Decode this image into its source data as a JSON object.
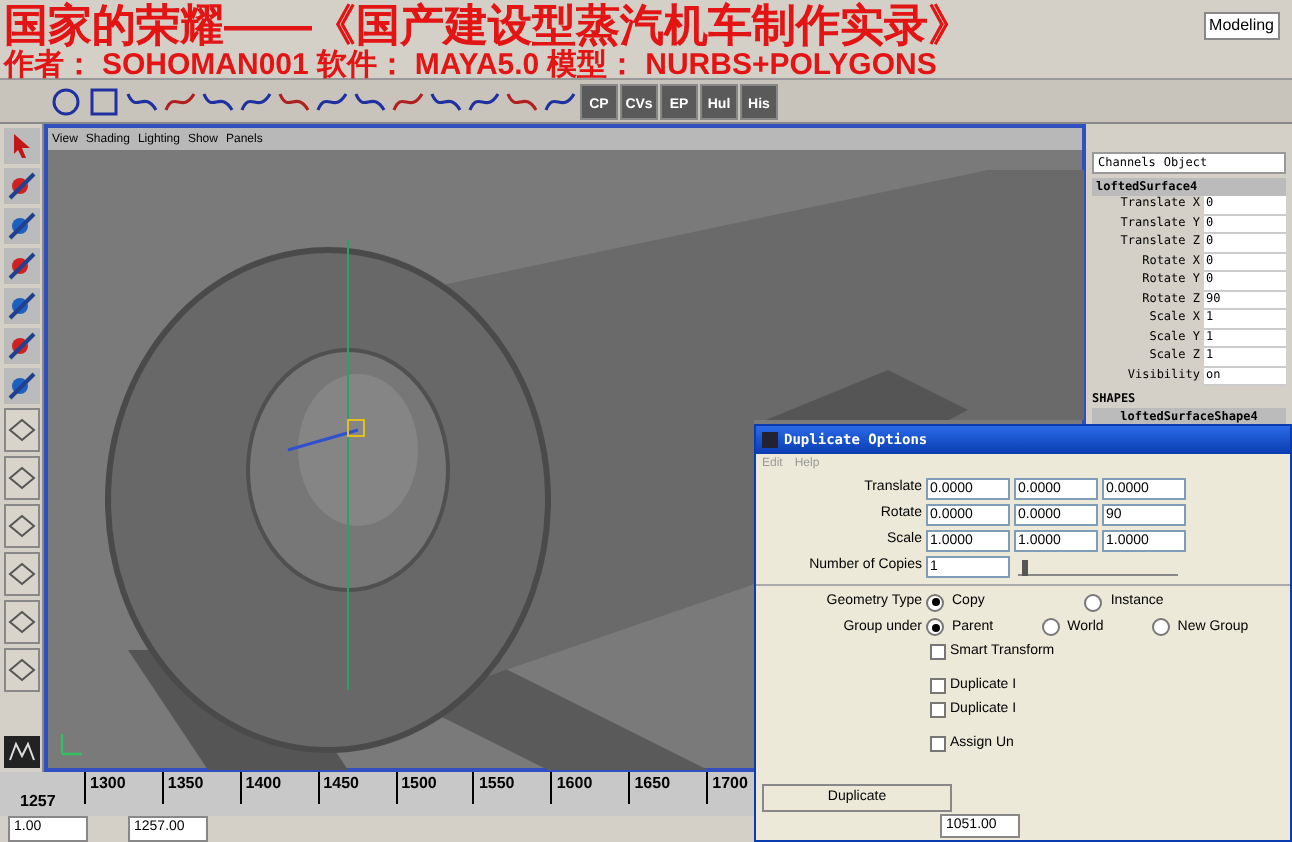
{
  "overlay_title": {
    "line_1": "国家的荣耀——《国产建设型蒸汽机车制作实录》",
    "line_2": [
      "作者：",
      "SOHOMAN001",
      "软件：",
      "MAYA5.0",
      "模型：",
      "NURBS+POLYGONS"
    ]
  },
  "menu_mode": "Modeling",
  "shelf": {
    "labeled_tools": [
      "CP",
      "CVs",
      "EP",
      "Hul",
      "His"
    ]
  },
  "viewport": {
    "menu": [
      "View",
      "Shading",
      "Lighting",
      "Show",
      "Panels"
    ]
  },
  "channel_box": {
    "tabs": [
      "Channels",
      "Object"
    ],
    "node": "loftedSurface4",
    "attributes": [
      {
        "name": "Translate X",
        "value": "0"
      },
      {
        "name": "Translate Y",
        "value": "0"
      },
      {
        "name": "Translate Z",
        "value": "0"
      },
      {
        "name": "Rotate X",
        "value": "0"
      },
      {
        "name": "Rotate Y",
        "value": "0"
      },
      {
        "name": "Rotate Z",
        "value": "90"
      },
      {
        "name": "Scale X",
        "value": "1"
      },
      {
        "name": "Scale Y",
        "value": "1"
      },
      {
        "name": "Scale Z",
        "value": "1"
      },
      {
        "name": "Visibility",
        "value": "on"
      }
    ],
    "shapes_heading": "SHAPES",
    "shape_node": "loftedSurfaceShape4"
  },
  "dialog": {
    "title": "Duplicate Options",
    "menu": [
      "Edit",
      "Help"
    ],
    "vector_rows": [
      {
        "label": "Translate",
        "values": [
          "0.0000",
          "0.0000",
          "0.0000"
        ]
      },
      {
        "label": "Rotate",
        "values": [
          "0.0000",
          "0.0000",
          "90"
        ]
      },
      {
        "label": "Scale",
        "values": [
          "1.0000",
          "1.0000",
          "1.0000"
        ]
      }
    ],
    "copies": {
      "label": "Number of Copies",
      "value": "1",
      "level": 0.02
    },
    "geometry_type": {
      "label": "Geometry Type",
      "options": [
        {
          "label": "Copy",
          "selected": true
        },
        {
          "label": "Instance",
          "selected": false
        }
      ]
    },
    "group_under": {
      "label": "Group under",
      "options": [
        {
          "label": "Parent",
          "selected": true
        },
        {
          "label": "World",
          "selected": false
        },
        {
          "label": "New Group",
          "selected": false
        }
      ]
    },
    "checkboxes": [
      {
        "label": "Smart Transform",
        "checked": false
      },
      {
        "label": "Duplicate I",
        "checked": false
      },
      {
        "label": "Duplicate I",
        "checked": false
      },
      {
        "label": "Assign Un",
        "checked": false
      }
    ],
    "button": "Duplicate"
  },
  "timeline": {
    "current": "1257",
    "ticks": [
      "1300",
      "1350",
      "1400",
      "1450",
      "1500",
      "1550",
      "1600",
      "1650",
      "1700"
    ]
  },
  "range": {
    "start": "1.00",
    "current": "1257.00",
    "end": "1051.00"
  }
}
